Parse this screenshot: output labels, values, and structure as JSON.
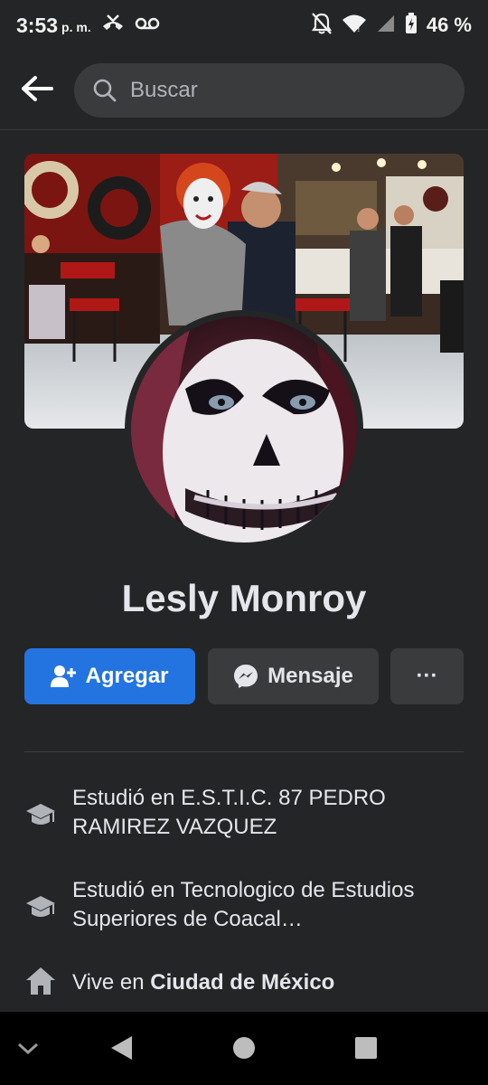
{
  "status_bar": {
    "time": "3:53",
    "ampm": "p. m.",
    "battery": "46 %"
  },
  "search": {
    "placeholder": "Buscar"
  },
  "profile": {
    "name": "Lesly Monroy"
  },
  "actions": {
    "add_label": "Agregar",
    "message_label": "Mensaje",
    "more_label": "···"
  },
  "info": {
    "items": [
      {
        "icon": "graduation-cap-icon",
        "text": "Estudió en E.S.T.I.C. 87 PEDRO RAMIREZ VAZQUEZ"
      },
      {
        "icon": "graduation-cap-icon",
        "text": "Estudió en Tecnologico de Estudios Superiores de Coacal…"
      },
      {
        "icon": "home-icon",
        "prefix": "Vive en ",
        "place": "Ciudad de México"
      }
    ]
  },
  "colors": {
    "background": "#242526",
    "accent": "#2374e1",
    "secondary_button": "#3a3b3c",
    "text": "#e4e6eb"
  }
}
